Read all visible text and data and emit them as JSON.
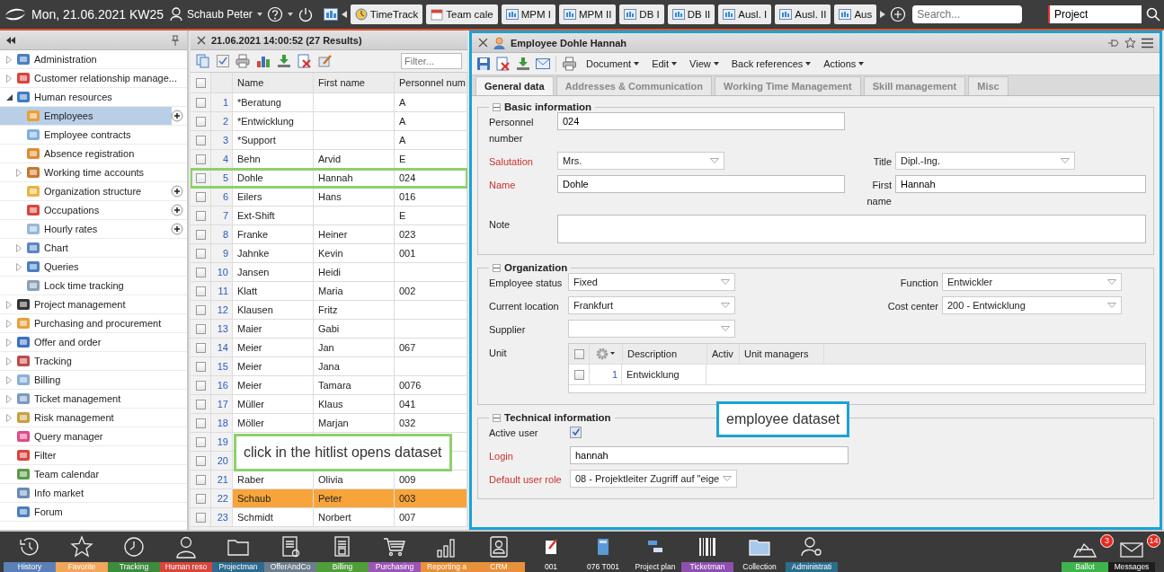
{
  "top_bar": {
    "date": "Mon, 21.06.2021 KW25",
    "user": "Schaub Peter",
    "tabs": [
      {
        "label": "TimeTrack",
        "kind": "tracking"
      },
      {
        "label": "Team cale",
        "kind": "calendar"
      },
      {
        "label": "MPM I",
        "kind": "module"
      },
      {
        "label": "MPM II",
        "kind": "module"
      },
      {
        "label": "DB I",
        "kind": "module"
      },
      {
        "label": "DB II",
        "kind": "module"
      },
      {
        "label": "Ausl. I",
        "kind": "module"
      },
      {
        "label": "Ausl. II",
        "kind": "module"
      },
      {
        "label": "Aus",
        "kind": "module"
      }
    ],
    "search": {
      "placeholder": "Search..."
    },
    "scope": {
      "value": "Project"
    }
  },
  "sidebar": {
    "items": [
      {
        "label": "Administration",
        "expanded": false,
        "selected": false,
        "addable": false
      },
      {
        "label": "Customer relationship manage...",
        "expanded": false,
        "selected": false,
        "addable": false
      },
      {
        "label": "Human resources",
        "expanded": true,
        "selected": false,
        "addable": false,
        "children": [
          {
            "label": "Employees",
            "selected": true,
            "addable": true
          },
          {
            "label": "Employee contracts",
            "selected": false,
            "addable": false
          },
          {
            "label": "Absence registration",
            "selected": false,
            "addable": false
          },
          {
            "label": "Working time accounts",
            "expanded": false,
            "selected": false,
            "addable": false
          },
          {
            "label": "Organization structure",
            "selected": false,
            "addable": true
          },
          {
            "label": "Occupations",
            "selected": false,
            "addable": true
          },
          {
            "label": "Hourly rates",
            "selected": false,
            "addable": true
          },
          {
            "label": "Chart",
            "expanded": false,
            "selected": false,
            "addable": false
          },
          {
            "label": "Queries",
            "expanded": false,
            "selected": false,
            "addable": false
          },
          {
            "label": "Lock time tracking",
            "selected": false,
            "addable": false
          }
        ]
      },
      {
        "label": "Project management",
        "expanded": false,
        "selected": false,
        "addable": false
      },
      {
        "label": "Purchasing and procurement",
        "expanded": false,
        "selected": false,
        "addable": false
      },
      {
        "label": "Offer and order",
        "expanded": false,
        "selected": false,
        "addable": false
      },
      {
        "label": "Tracking",
        "expanded": false,
        "selected": false,
        "addable": false
      },
      {
        "label": "Billing",
        "expanded": false,
        "selected": false,
        "addable": false
      },
      {
        "label": "Ticket management",
        "expanded": false,
        "selected": false,
        "addable": false
      },
      {
        "label": "Risk management",
        "expanded": false,
        "selected": false,
        "addable": false
      },
      {
        "label": "Query manager",
        "selected": false,
        "addable": false
      },
      {
        "label": "Filter",
        "selected": false,
        "addable": false
      },
      {
        "label": "Team calendar",
        "selected": false,
        "addable": false
      },
      {
        "label": "Info market",
        "selected": false,
        "addable": false
      },
      {
        "label": "Forum",
        "selected": false,
        "addable": false
      }
    ]
  },
  "hitlist": {
    "title": "21.06.2021 14:00:52 (27 Results)",
    "filter": {
      "placeholder": "Filter..."
    },
    "columns": [
      "Name",
      "First name",
      "Personnel num"
    ],
    "all_checked": false,
    "rows": [
      {
        "num": "1",
        "cells": [
          "*Beratung",
          "",
          "A"
        ],
        "checked": false,
        "selected": false,
        "framed": false
      },
      {
        "num": "2",
        "cells": [
          "*Entwicklung",
          "",
          "A"
        ],
        "checked": false,
        "selected": false,
        "framed": false
      },
      {
        "num": "3",
        "cells": [
          "*Support",
          "",
          "A"
        ],
        "checked": false,
        "selected": false,
        "framed": false
      },
      {
        "num": "4",
        "cells": [
          "Behn",
          "Arvid",
          "E"
        ],
        "checked": false,
        "selected": false,
        "framed": false
      },
      {
        "num": "5",
        "cells": [
          "Dohle",
          "Hannah",
          "024"
        ],
        "checked": false,
        "selected": false,
        "framed": true
      },
      {
        "num": "6",
        "cells": [
          "Eilers",
          "Hans",
          "016"
        ],
        "checked": false,
        "selected": false,
        "framed": false
      },
      {
        "num": "7",
        "cells": [
          "Ext-Shift",
          "",
          "E"
        ],
        "checked": false,
        "selected": false,
        "framed": false
      },
      {
        "num": "8",
        "cells": [
          "Franke",
          "Heiner",
          "023"
        ],
        "checked": false,
        "selected": false,
        "framed": false
      },
      {
        "num": "9",
        "cells": [
          "Jahnke",
          "Kevin",
          "001"
        ],
        "checked": false,
        "selected": false,
        "framed": false
      },
      {
        "num": "10",
        "cells": [
          "Jansen",
          "Heidi",
          ""
        ],
        "checked": false,
        "selected": false,
        "framed": false
      },
      {
        "num": "11",
        "cells": [
          "Klatt",
          "Maria",
          "002"
        ],
        "checked": false,
        "selected": false,
        "framed": false
      },
      {
        "num": "12",
        "cells": [
          "Klausen",
          "Fritz",
          ""
        ],
        "checked": false,
        "selected": false,
        "framed": false
      },
      {
        "num": "13",
        "cells": [
          "Maier",
          "Gabi",
          ""
        ],
        "checked": false,
        "selected": false,
        "framed": false
      },
      {
        "num": "14",
        "cells": [
          "Meier",
          "Jan",
          "067"
        ],
        "checked": false,
        "selected": false,
        "framed": false
      },
      {
        "num": "15",
        "cells": [
          "Meier",
          "Jana",
          ""
        ],
        "checked": false,
        "selected": false,
        "framed": false
      },
      {
        "num": "16",
        "cells": [
          "Meier",
          "Tamara",
          "0076"
        ],
        "checked": false,
        "selected": false,
        "framed": false
      },
      {
        "num": "17",
        "cells": [
          "Müller",
          "Klaus",
          "041"
        ],
        "checked": false,
        "selected": false,
        "framed": false
      },
      {
        "num": "18",
        "cells": [
          "Möller",
          "Marjan",
          "032"
        ],
        "checked": false,
        "selected": false,
        "framed": false
      },
      {
        "num": "19",
        "checked": false,
        "selected": false,
        "framed": false
      },
      {
        "num": "20",
        "checked": false,
        "selected": false,
        "framed": false
      },
      {
        "num": "21",
        "cells": [
          "Raber",
          "Olivia",
          "009"
        ],
        "checked": false,
        "selected": false,
        "framed": false
      },
      {
        "num": "22",
        "cells": [
          "Schaub",
          "Peter",
          "003"
        ],
        "checked": false,
        "selected": true,
        "framed": false
      },
      {
        "num": "23",
        "cells": [
          "Schmidt",
          "Norbert",
          "007"
        ],
        "checked": false,
        "selected": false,
        "framed": false
      }
    ],
    "callout": "click in the hitlist opens dataset"
  },
  "record": {
    "title": "Employee Dohle Hannah",
    "menus": [
      "Document",
      "Edit",
      "View",
      "Back references",
      "Actions"
    ],
    "tabs": [
      {
        "label": "General data",
        "selected": true
      },
      {
        "label": "Addresses & Communication",
        "selected": false
      },
      {
        "label": "Working Time Management",
        "selected": false
      },
      {
        "label": "Skill management",
        "selected": false
      },
      {
        "label": "Misc",
        "selected": false
      }
    ],
    "sections": [
      {
        "title": "Basic information",
        "rows": [
          [
            {
              "label": "Personnel number",
              "kind": "text",
              "value": "024",
              "required": false
            }
          ],
          [
            {
              "label": "Salutation",
              "kind": "select",
              "value": "Mrs.",
              "required": true
            },
            {
              "label": "Title",
              "kind": "select",
              "value": "Dipl.-Ing.",
              "required": false
            }
          ],
          [
            {
              "label": "Name",
              "kind": "text",
              "value": "Dohle",
              "required": true
            },
            {
              "label": "First name",
              "kind": "text",
              "value": "Hannah",
              "required": false
            }
          ],
          [
            {
              "label": "Note",
              "kind": "textarea",
              "required": false
            }
          ]
        ]
      },
      {
        "title": "Organization",
        "rows": [
          [
            {
              "label": "Employee status",
              "kind": "select",
              "value": "Fixed",
              "required": false
            },
            {
              "label": "Function",
              "kind": "select",
              "value": "Entwickler",
              "required": false
            }
          ],
          [
            {
              "label": "Current location",
              "kind": "select",
              "value": "Frankfurt",
              "required": false
            },
            {
              "label": "Cost center",
              "kind": "select",
              "value": "200 - Entwicklung",
              "required": false
            }
          ],
          [
            {
              "label": "Supplier",
              "kind": "select",
              "required": false
            }
          ],
          [
            {
              "label": "Unit",
              "kind": "grid",
              "required": false,
              "all_checked": false,
              "columns": [
                "Description",
                "Activ",
                "Unit managers"
              ],
              "rows": [
                {
                  "num": "1",
                  "cells": [
                    "Entwicklung"
                  ],
                  "checked": false
                }
              ]
            }
          ]
        ]
      },
      {
        "title": "Technical information",
        "rows": [
          [
            {
              "label": "Active user",
              "kind": "checkbox",
              "checked": true,
              "required": false
            }
          ],
          [
            {
              "label": "Login",
              "kind": "text",
              "value": "hannah",
              "required": true
            }
          ],
          [
            {
              "label": "Default user role",
              "kind": "select",
              "value": "08 - Projektleiter Zugriff auf \"eige",
              "required": true
            }
          ]
        ]
      }
    ],
    "callout": "employee dataset"
  },
  "taskbar": {
    "items": [
      {
        "label": "History",
        "color": "#5b80b8"
      },
      {
        "label": "Favorite",
        "color": "#f2a65a"
      },
      {
        "label": "Tracking",
        "color": "#3d8b3d"
      },
      {
        "label": "Human reso",
        "color": "#d9453d"
      },
      {
        "label": "Projectman",
        "color": "#2f6b8f"
      },
      {
        "label": "OfferAndCo",
        "color": "#6d7f8e"
      },
      {
        "label": "Billing",
        "color": "#4f9e3a"
      },
      {
        "label": "Purchasing",
        "color": "#9b55b5"
      },
      {
        "label": "Reporting a",
        "color": "#e8913a"
      },
      {
        "label": "CRM",
        "color": "#e8913a"
      },
      {
        "label": "001"
      },
      {
        "label": "076 T001"
      },
      {
        "label": "Project plan"
      },
      {
        "label": "Ticketman",
        "color": "#8e4fae"
      },
      {
        "label": "Collection"
      },
      {
        "label": "Administrati",
        "color": "#2a6d8c"
      }
    ],
    "right": [
      {
        "label": "Ballot",
        "badge": "3",
        "color": "#3fb44c"
      },
      {
        "label": "Messages",
        "badge": "14",
        "color": "#1e1e1e"
      }
    ]
  }
}
